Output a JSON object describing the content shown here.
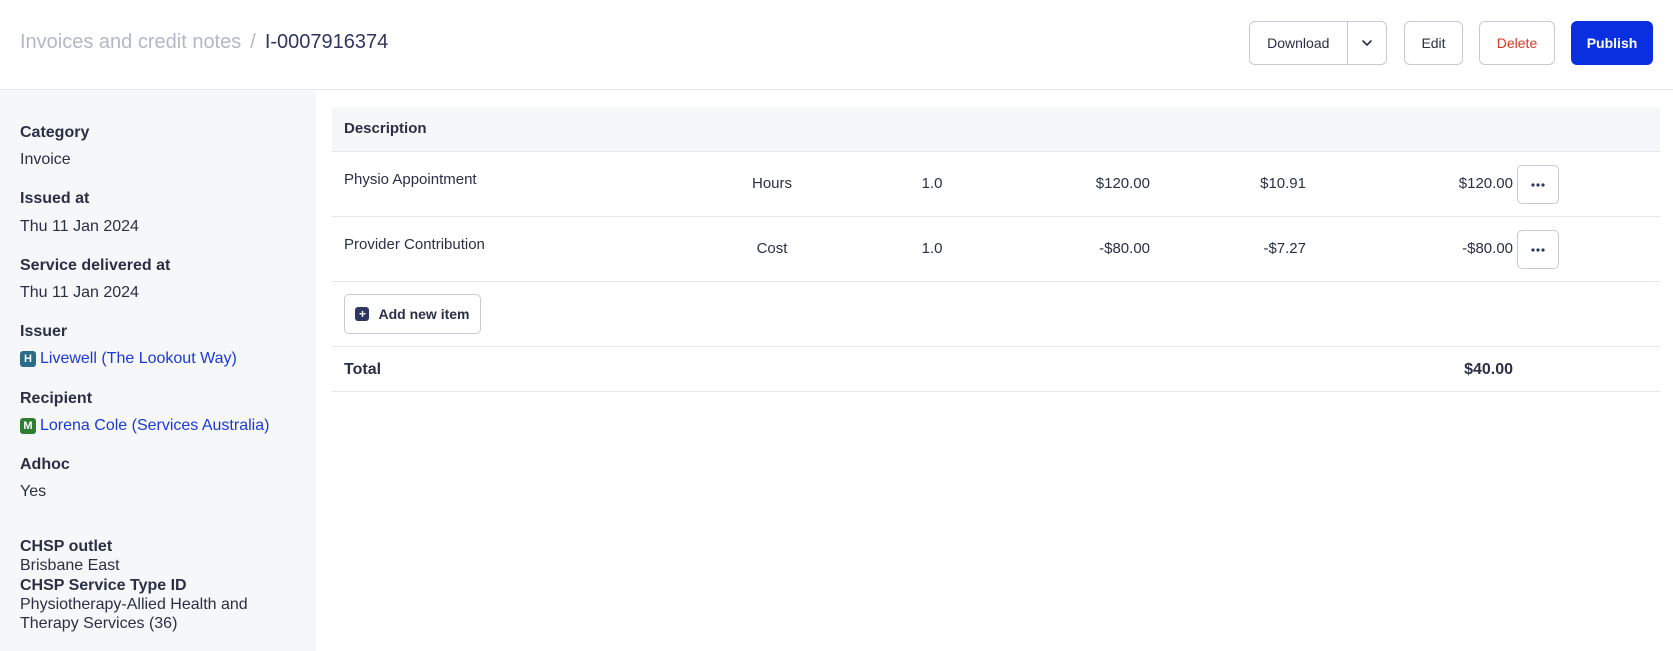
{
  "breadcrumb": {
    "parent": "Invoices and credit notes",
    "separator": "/",
    "current": "I-0007916374"
  },
  "toolbar": {
    "download_label": "Download",
    "edit_label": "Edit",
    "delete_label": "Delete",
    "publish_label": "Publish",
    "delete_color": "#d63a1f",
    "publish_color": "#0a2fe0"
  },
  "sidebar": {
    "category": {
      "label": "Category",
      "value": "Invoice"
    },
    "issued_at": {
      "label": "Issued at",
      "value": "Thu 11 Jan 2024"
    },
    "service_delivered_at": {
      "label": "Service delivered at",
      "value": "Thu 11 Jan 2024"
    },
    "issuer": {
      "label": "Issuer",
      "badge": "H",
      "badge_color": "#2c6b8a",
      "value": "Livewell (The Lookout Way)"
    },
    "recipient": {
      "label": "Recipient",
      "badge": "M",
      "badge_color": "#2f7d32",
      "value": "Lorena Cole (Services Australia)"
    },
    "adhoc": {
      "label": "Adhoc",
      "value": "Yes"
    },
    "chsp_outlet": {
      "label": "CHSP outlet",
      "value": "Brisbane East"
    },
    "chsp_service_type": {
      "label": "CHSP Service Type ID",
      "value": "Physiotherapy-Allied Health and Therapy Services (36)"
    }
  },
  "table": {
    "header": "Description",
    "rows": [
      {
        "description": "Physio Appointment",
        "unit": "Hours",
        "quantity": "1.0",
        "rate": "$120.00",
        "tax": "$10.91",
        "amount": "$120.00"
      },
      {
        "description": "Provider Contribution",
        "unit": "Cost",
        "quantity": "1.0",
        "rate": "-$80.00",
        "tax": "-$7.27",
        "amount": "-$80.00"
      }
    ],
    "add_item_label": "Add new item",
    "total_label": "Total",
    "total_value": "$40.00"
  },
  "icons": {
    "download_caret": "chevron-down-icon",
    "row_menu": "more-horizontal-icon",
    "add_item": "plus-square-icon"
  }
}
